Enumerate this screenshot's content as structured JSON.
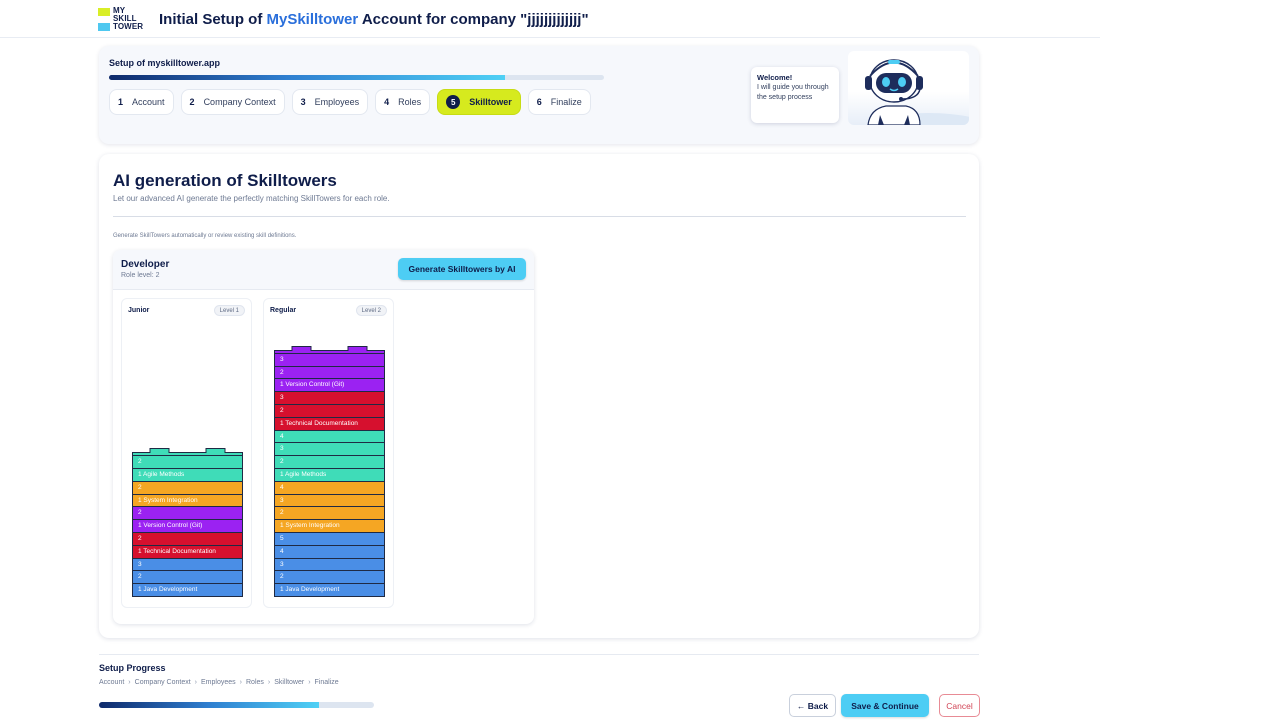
{
  "header": {
    "logo_lines": [
      "MY",
      "SKILL",
      "TOWER"
    ],
    "title_prefix": "Initial Setup of ",
    "title_brand": "MySkilltower",
    "title_suffix": " Account for company \"jjjjjjjjjjjjj\""
  },
  "setup": {
    "title": "Setup of myskilltower.app",
    "progress_fraction": 0.8,
    "steps": [
      {
        "num": "1",
        "label": "Account"
      },
      {
        "num": "2",
        "label": "Company Context"
      },
      {
        "num": "3",
        "label": "Employees"
      },
      {
        "num": "4",
        "label": "Roles"
      },
      {
        "num": "5",
        "label": "Skilltower"
      },
      {
        "num": "6",
        "label": "Finalize"
      }
    ],
    "active_step": 5,
    "assistant": {
      "greeting": "Welcome!",
      "message": "I will guide you through the setup process"
    }
  },
  "main": {
    "title": "AI generation of Skilltowers",
    "subtitle": "Let our advanced AI generate the perfectly matching SkillTowers for each role.",
    "hint": "Generate SkillTowers automatically or review existing skill definitions.",
    "role": {
      "name": "Developer",
      "level": "Role level: 2",
      "generate_label": "Generate Skilltowers by AI",
      "levels": [
        {
          "name": "Junior",
          "badge": "Level 1",
          "bricks": [
            {
              "label": "2",
              "color": "#3fdcb8"
            },
            {
              "label": "1 Agile Methods",
              "color": "#3fdcb8"
            },
            {
              "label": "2",
              "color": "#f5a623"
            },
            {
              "label": "1 System Integration",
              "color": "#f5a623"
            },
            {
              "label": "2",
              "color": "#9b22f2"
            },
            {
              "label": "1 Version Control (Git)",
              "color": "#9b22f2"
            },
            {
              "label": "2",
              "color": "#d6102e"
            },
            {
              "label": "1 Technical Documentation",
              "color": "#d6102e"
            },
            {
              "label": "3",
              "color": "#4a8ee6"
            },
            {
              "label": "2",
              "color": "#4a8ee6"
            },
            {
              "label": "1 Java Development",
              "color": "#4a8ee6"
            }
          ]
        },
        {
          "name": "Regular",
          "badge": "Level 2",
          "bricks": [
            {
              "label": "3",
              "color": "#9b22f2"
            },
            {
              "label": "2",
              "color": "#9b22f2"
            },
            {
              "label": "1 Version Control (Git)",
              "color": "#9b22f2"
            },
            {
              "label": "3",
              "color": "#d6102e"
            },
            {
              "label": "2",
              "color": "#d6102e"
            },
            {
              "label": "1 Technical Documentation",
              "color": "#d6102e"
            },
            {
              "label": "4",
              "color": "#3fdcb8"
            },
            {
              "label": "3",
              "color": "#3fdcb8"
            },
            {
              "label": "2",
              "color": "#3fdcb8"
            },
            {
              "label": "1 Agile Methods",
              "color": "#3fdcb8"
            },
            {
              "label": "4",
              "color": "#f5a623"
            },
            {
              "label": "3",
              "color": "#f5a623"
            },
            {
              "label": "2",
              "color": "#f5a623"
            },
            {
              "label": "1 System Integration",
              "color": "#f5a623"
            },
            {
              "label": "5",
              "color": "#4a8ee6"
            },
            {
              "label": "4",
              "color": "#4a8ee6"
            },
            {
              "label": "3",
              "color": "#4a8ee6"
            },
            {
              "label": "2",
              "color": "#4a8ee6"
            },
            {
              "label": "1 Java Development",
              "color": "#4a8ee6"
            }
          ]
        }
      ]
    }
  },
  "footer": {
    "title": "Setup Progress",
    "crumbs": [
      "Account",
      "Company Context",
      "Employees",
      "Roles",
      "Skilltower",
      "Finalize"
    ],
    "crumb_separator": "›",
    "progress_fraction": 0.8,
    "back_label": "← Back",
    "save_label": "Save & Continue",
    "cancel_label": "Cancel"
  },
  "colors": {
    "accent": "#4dcdf4",
    "active_step": "#d6ea1e",
    "brand_text": "#2a6fdb",
    "navy": "#0f1d4a"
  }
}
